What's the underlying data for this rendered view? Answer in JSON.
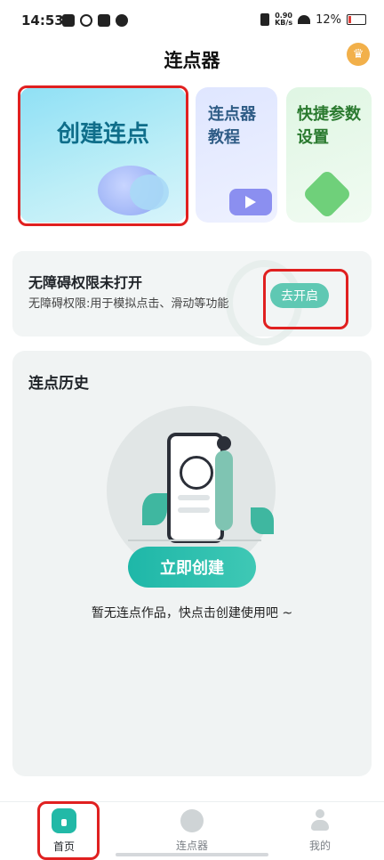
{
  "status_bar": {
    "time": "14:53",
    "net_speed_value": "0.90",
    "net_speed_unit": "KB/s",
    "battery": "12%"
  },
  "header": {
    "title": "连点器",
    "vip_badge_icon": "crown-icon"
  },
  "cards": {
    "create_label": "创建连点",
    "tutorial_label_1": "连点器",
    "tutorial_label_2": "教程",
    "settings_label_1": "快捷参数",
    "settings_label_2": "设置"
  },
  "accessibility": {
    "title": "无障碍权限未打开",
    "description": "无障碍权限:用于模拟点击、滑动等功能",
    "button_label": "去开启"
  },
  "history": {
    "title": "连点历史",
    "create_button_label": "立即创建",
    "empty_text": "暂无连点作品，快点击创建使用吧 ~"
  },
  "bottom_nav": {
    "items": [
      {
        "label": "首页",
        "icon": "home-icon",
        "active": true
      },
      {
        "label": "连点器",
        "icon": "clicker-icon",
        "active": false
      },
      {
        "label": "我的",
        "icon": "profile-icon",
        "active": false
      }
    ]
  },
  "colors": {
    "accent": "#22b9a7",
    "highlight": "#e02020"
  }
}
